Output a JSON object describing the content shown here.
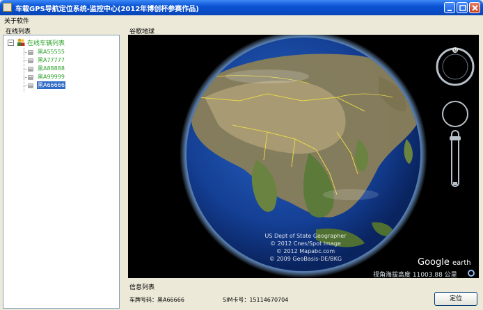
{
  "window": {
    "title": "车载GPS导航定位系统-监控中心(2012年博创杯参赛作品)",
    "icon": "app-icon"
  },
  "menu": {
    "items": [
      {
        "label": "关于软件"
      }
    ]
  },
  "online_panel": {
    "title": "在线列表",
    "root_label": "在线车辆列表",
    "root_expander": "−",
    "vehicles": [
      {
        "plate": "黑A55555",
        "selected": false
      },
      {
        "plate": "黑A77777",
        "selected": false
      },
      {
        "plate": "黑A88888",
        "selected": false
      },
      {
        "plate": "黑A99999",
        "selected": false
      },
      {
        "plate": "黑A66666",
        "selected": true
      }
    ]
  },
  "map_panel": {
    "title": "谷歌地球",
    "copyright_lines": [
      "US Dept of State Geographer",
      "© 2012 Cnes/Spot Image",
      "© 2012 Mapabc.com",
      "© 2009 GeoBasis-DE/BKG"
    ],
    "brand": "Google",
    "brand_suffix": "earth",
    "altitude_text": "视角海拔高度 11003.88 公里"
  },
  "info_panel": {
    "title": "信息列表",
    "plate_label": "车牌号码：黑A66666",
    "sim_label": "SIM卡号：15114670704",
    "locate_button": "定位"
  },
  "colors": {
    "titlebar": "#0a53d4",
    "tree_text": "#2aa22a",
    "selection": "#316ac5",
    "ocean": "#1a4fa8"
  }
}
